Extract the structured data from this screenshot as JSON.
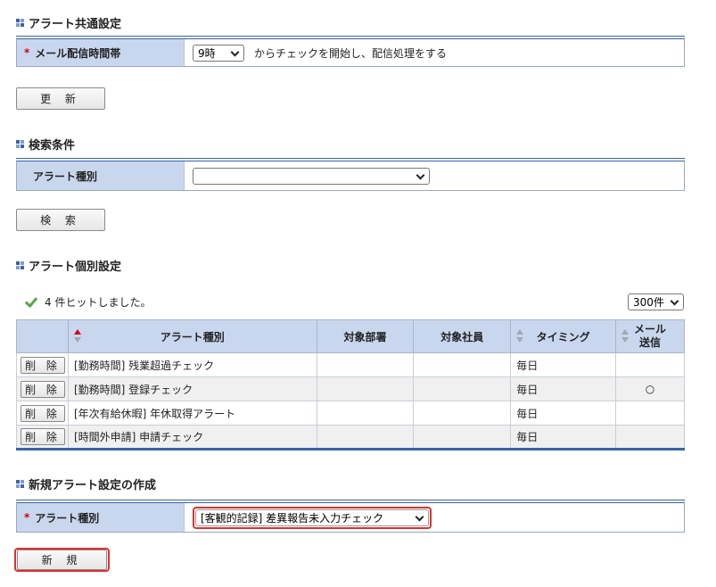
{
  "common": {
    "title": "アラート共通設定",
    "label": "メール配信時間帯",
    "required_mark": "*",
    "hour_value": "9時",
    "note": "からチェックを開始し、配信処理をする",
    "update_button": "更 新"
  },
  "search": {
    "title": "検索条件",
    "label": "アラート種別",
    "select_value": "",
    "search_button": "検 索"
  },
  "individual": {
    "title": "アラート個別設定",
    "hit_text": "4 件ヒットしました。",
    "per_page": "300件",
    "headers": [
      "アラート種別",
      "対象部署",
      "対象社員",
      "タイミング",
      "メール",
      "送信"
    ],
    "delete_label": "削 除",
    "rows": [
      {
        "type": "[勤務時間] 残業超過チェック",
        "dept": "",
        "emp": "",
        "timing": "毎日",
        "mail": ""
      },
      {
        "type": "[勤務時間] 登録チェック",
        "dept": "",
        "emp": "",
        "timing": "毎日",
        "mail": "○"
      },
      {
        "type": "[年次有給休暇] 年休取得アラート",
        "dept": "",
        "emp": "",
        "timing": "毎日",
        "mail": ""
      },
      {
        "type": "[時間外申請] 申請チェック",
        "dept": "",
        "emp": "",
        "timing": "毎日",
        "mail": ""
      }
    ]
  },
  "create": {
    "title": "新規アラート設定の作成",
    "label": "アラート種別",
    "required_mark": "*",
    "select_value": "[客観的記録] 差異報告未入力チェック",
    "new_button": "新 規"
  },
  "colors": {
    "accent": "#3a62a8",
    "label_bg": "#c9d7ee",
    "required": "#d0021b",
    "highlight": "#e03030",
    "check": "#58a845"
  }
}
